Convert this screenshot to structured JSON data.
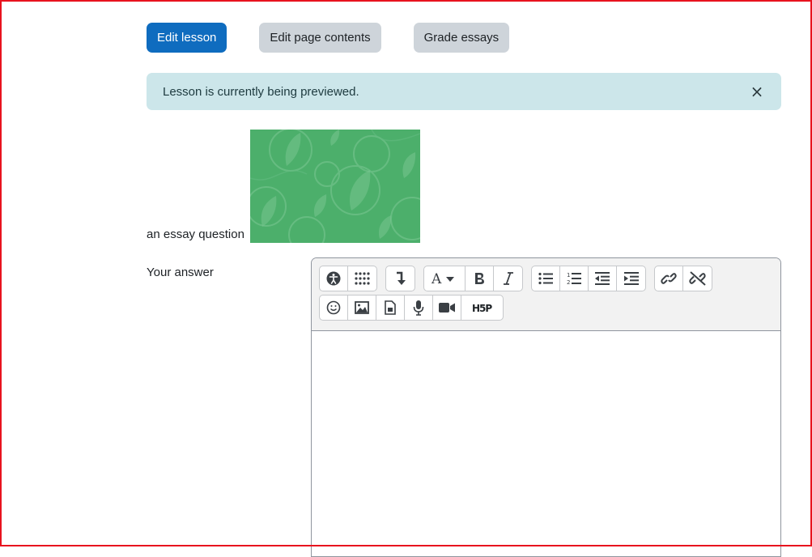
{
  "actions": {
    "edit_lesson": "Edit lesson",
    "edit_page_contents": "Edit page contents",
    "grade_essays": "Grade essays"
  },
  "alert": {
    "message": "Lesson is currently being previewed.",
    "close_symbol": "×"
  },
  "question": {
    "text": "an essay question",
    "image_color": "#4caf6b"
  },
  "answer": {
    "label": "Your answer"
  },
  "editor_toolbar": {
    "row1": [
      [
        "accessibility-checker-icon",
        "screenreader-helper-icon"
      ],
      [
        "toolbar-toggle-icon"
      ],
      [
        "font-color-icon",
        "bold-icon",
        "italic-icon"
      ],
      [
        "unordered-list-icon",
        "ordered-list-icon",
        "outdent-icon",
        "indent-icon"
      ],
      [
        "link-icon",
        "unlink-icon"
      ]
    ],
    "row2": [
      [
        "emoji-icon",
        "image-icon",
        "media-file-icon",
        "record-audio-icon",
        "record-video-icon",
        "h5p-icon"
      ]
    ]
  },
  "colors": {
    "primary": "#0f6cbf",
    "secondary": "#ced4da",
    "alert_bg": "#cce6ea",
    "frame": "#e8131e"
  }
}
